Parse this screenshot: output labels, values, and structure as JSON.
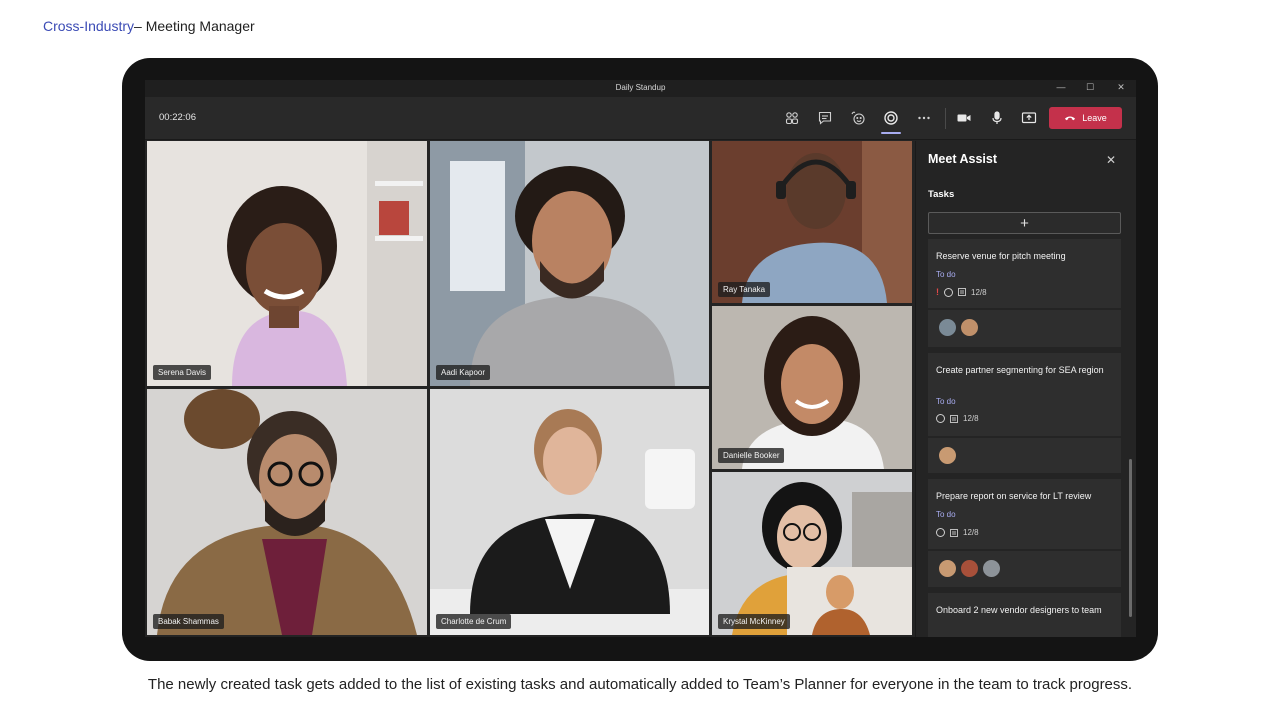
{
  "slide": {
    "breadcrumb": "Cross-Industry",
    "separator": "– ",
    "section": "Meeting Manager",
    "caption": "The newly created task gets added to the list of existing tasks and automatically added  to Team’s Planner for everyone in the team to track progress."
  },
  "window": {
    "title": "Daily Standup",
    "minimize": "—",
    "maximize": "☐",
    "close": "✕"
  },
  "toolbar": {
    "timer": "00:22:06",
    "icons": [
      "people-icon",
      "chat-icon",
      "reactions-icon",
      "meet-assist-icon",
      "more-icon",
      "camera-icon",
      "mic-icon",
      "share-icon"
    ],
    "leave_label": "Leave",
    "accent": "#c4314b"
  },
  "participants": [
    {
      "name": "Serena Davis"
    },
    {
      "name": "Aadi Kapoor"
    },
    {
      "name": "Ray Tanaka"
    },
    {
      "name": "Danielle Booker"
    },
    {
      "name": "Babak Shammas"
    },
    {
      "name": "Charlotte de Crum"
    },
    {
      "name": "Krystal McKinney"
    }
  ],
  "panel": {
    "title": "Meet Assist",
    "close": "✕",
    "tasks_label": "Tasks",
    "add_label": "+",
    "tasks": [
      {
        "title": "Reserve venue for pitch meeting",
        "status": "To do",
        "urgent": "!",
        "date": "12/8",
        "assignees": 2
      },
      {
        "title": "Create partner segmenting for SEA region",
        "status": "To do",
        "date": "12/8",
        "assignees": 1
      },
      {
        "title": "Prepare report on service for LT review",
        "status": "To do",
        "date": "12/8",
        "assignees": 3
      },
      {
        "title": "Onboard 2 new vendor designers to team"
      }
    ]
  }
}
